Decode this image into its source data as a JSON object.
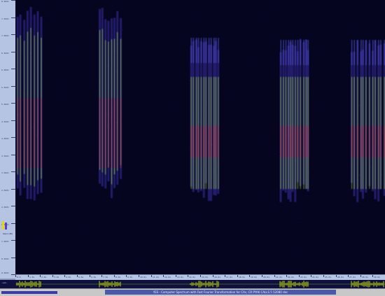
{
  "frequency_ruler": {
    "ticks": [
      "8.0kHz",
      "7.5kHz",
      "7.0kHz",
      "6.5kHz",
      "6.0kHz",
      "5.5kHz",
      "5.0kHz",
      "4.5kHz",
      "4.0kHz",
      "3.5kHz",
      "3.0kHz",
      "2.5kHz",
      "2.0kHz",
      "1.5kHz",
      "1.0kHz",
      "0.5kHz",
      "0.0kHz"
    ],
    "amplitude_label": "Ampl(dB)"
  },
  "time_axis": {
    "labels": [
      "0.0",
      "1.0s",
      "2.0s",
      "3.0s",
      "4.0s",
      "5.0s",
      "6.0s",
      "7.0s",
      "8.0s",
      "9.0s",
      "10.0s",
      "11.0s",
      "12.0s",
      "13.0s",
      "14.0s",
      "15.0s",
      "16.0s",
      "17.0s",
      "18.0s",
      "19.0s",
      "20.0s",
      "21.0s",
      "22.0s",
      "23.0s",
      "24.0s",
      "25.0s",
      "26.0s",
      "27.0s",
      "28.0s",
      "29.0s"
    ]
  },
  "waveform": {
    "label": "-wav-",
    "color": "#c8e000"
  },
  "status_bar": {
    "title": "YES - Computer Spectrum with Fast Fourier Transformation for CAs, CR PYAK CALLS 5 52080 dec"
  },
  "colors": {
    "background": "#05051f",
    "low_energy": "#3a2ea8",
    "mid_energy": "#a8e030",
    "high_energy": "#e04040"
  }
}
